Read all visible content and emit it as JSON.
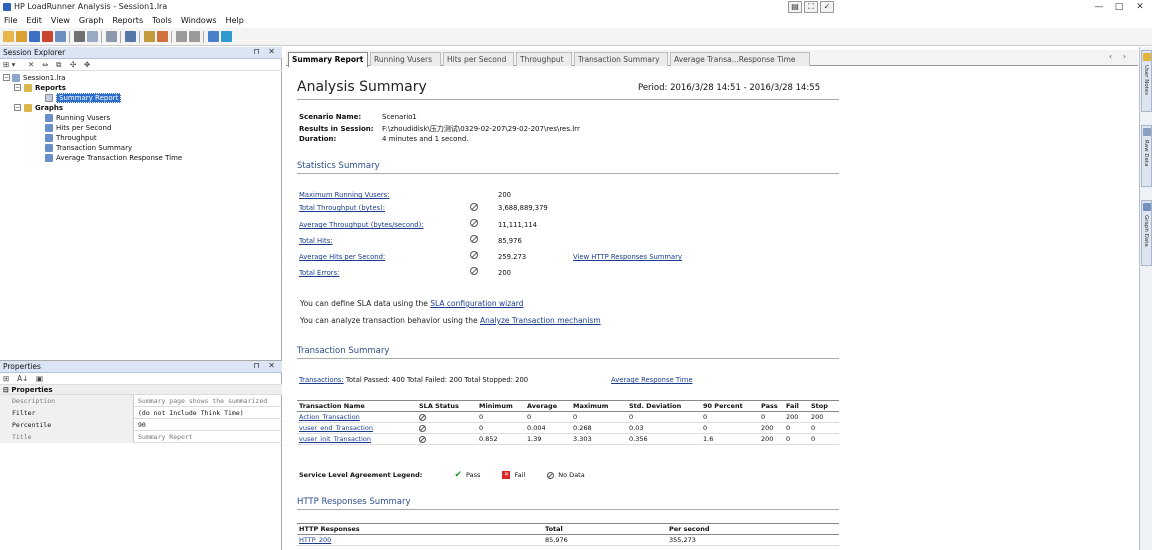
{
  "window": {
    "title": "HP LoadRunner Analysis - Session1.lra",
    "minimize": "—",
    "maximize": "□",
    "close": "✕",
    "center_controls": [
      "▤",
      "⛶",
      "✓"
    ]
  },
  "menu": [
    "File",
    "Edit",
    "View",
    "Graph",
    "Reports",
    "Tools",
    "Windows",
    "Help"
  ],
  "explorer": {
    "title": "Session Explorer",
    "pin": "⊓ ✕",
    "tools": [
      "⊞ ▾",
      "✕",
      "⇔",
      "⧉",
      "✣",
      "✥"
    ],
    "tree": {
      "session": "Session1.lra",
      "reports": "Reports",
      "summary_report": "Summary Report",
      "graphs": "Graphs",
      "graph_items": [
        "Running Vusers",
        "Hits per Second",
        "Throughput",
        "Transaction Summary",
        "Average Transaction Response Time"
      ]
    }
  },
  "properties": {
    "title": "Properties",
    "pin": "⊓ ✕",
    "tools": [
      "⊞",
      "A↓",
      "▣"
    ],
    "category": "Properties",
    "rows": [
      {
        "key": "Description",
        "value": "Summary page shows the summarized"
      },
      {
        "key": "Filter",
        "value": "(do not Include Think Time)"
      },
      {
        "key": "Percentile",
        "value": "90"
      },
      {
        "key": "Title",
        "value": "Summary Report"
      }
    ]
  },
  "tabs": {
    "items": [
      "Summary Report",
      "Running Vusers",
      "Hits per Second",
      "Throughput",
      "Transaction Summary",
      "Average Transa...Response Time"
    ],
    "scroll": "‹ ›"
  },
  "report": {
    "title": "Analysis Summary",
    "period": "Period: 2016/3/28 14:51 - 2016/3/28 14:55",
    "scenario_label": "Scenario Name:",
    "scenario_value": "Scenario1",
    "results_label": "Results in Session:",
    "results_value": "F:\\zhoudidisk\\压力测试\\0329-02-207\\29-02-207\\res\\res.lrr",
    "duration_label": "Duration:",
    "duration_value": "4 minutes and 1 second.",
    "statistics_title": "Statistics Summary",
    "stats": [
      {
        "label": "Maximum Running Vusers:",
        "value": "200"
      },
      {
        "label": "Total Throughput (bytes):",
        "value": "3,688,889,379"
      },
      {
        "label": "Average Throughput (bytes/second):",
        "value": "11,111,114"
      },
      {
        "label": "Total Hits:",
        "value": "85,976"
      },
      {
        "label": "Average Hits per Second:",
        "value": "259.273"
      },
      {
        "label": "Total Errors:",
        "value": "200"
      }
    ],
    "http_link": "View HTTP Responses Summary",
    "sla_note_prefix": "You can define SLA data using the",
    "sla_note_link": "SLA configuration wizard",
    "analyze_note_prefix": "You can analyze transaction behavior using the",
    "analyze_note_link": "Analyze Transaction mechanism",
    "transaction_title": "Transaction Summary",
    "transactions_link": "Transactions:",
    "transactions_text": "Total Passed: 400 Total Failed: 200 Total Stopped: 200",
    "avg_response_link": "Average Response Time",
    "tx_headers": [
      "Transaction Name",
      "SLA Status",
      "Minimum",
      "Average",
      "Maximum",
      "Std. Deviation",
      "90 Percent",
      "Pass",
      "Fail",
      "Stop"
    ],
    "tx_rows": [
      [
        "Action_Transaction",
        "",
        "0",
        "0",
        "0",
        "0",
        "0",
        "0",
        "200",
        "200"
      ],
      [
        "vuser_end_Transaction",
        "",
        "0",
        "0.004",
        "0.268",
        "0.03",
        "0",
        "200",
        "0",
        "0"
      ],
      [
        "vuser_init_Transaction",
        "",
        "0.852",
        "1.39",
        "3.303",
        "0.356",
        "1.6",
        "200",
        "0",
        "0"
      ]
    ],
    "legend_title": "Service Level Agreement Legend:",
    "legend_pass": "Pass",
    "legend_fail": "Fail",
    "legend_nodata": "No Data",
    "http_title": "HTTP Responses Summary",
    "http_headers": [
      "HTTP Responses",
      "Total",
      "Per second"
    ],
    "http_rows": [
      [
        "HTTP_200",
        "85,976",
        "355,273"
      ]
    ]
  },
  "right_sidebar": [
    "User Notes",
    "Raw Data",
    "Graph Data"
  ]
}
